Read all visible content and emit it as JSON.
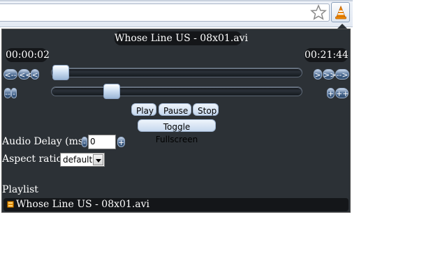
{
  "browser": {
    "star_icon": "star-icon",
    "extension_icon": "vlc-cone-icon"
  },
  "player": {
    "title": "Whose Line US - 08x01.avi",
    "time_current": "00:00:02",
    "time_total": "00:21:44",
    "seek_buttons_left": [
      "<--",
      "<<",
      "<"
    ],
    "seek_buttons_right": [
      ">",
      ">>",
      "-->"
    ],
    "volume_buttons_left": [
      "--",
      "-"
    ],
    "volume_buttons_right": [
      "+",
      "++"
    ],
    "seek_position": 0.0015,
    "volume_level": 0.25
  },
  "controls": {
    "play": "Play",
    "pause": "Pause",
    "stop": "Stop",
    "fullscreen": "Toggle Fullscreen"
  },
  "audio_delay": {
    "label": "Audio Delay (ms):",
    "minus": "-",
    "plus": "+",
    "value": "0"
  },
  "aspect": {
    "label": "Aspect ratio:",
    "selected": "default"
  },
  "playlist": {
    "label": "Playlist",
    "items": [
      {
        "name": "Whose Line US - 08x01.avi",
        "icon": "video-file-icon"
      }
    ]
  },
  "colors": {
    "panel_bg": "#2c3136",
    "pill_bg": "#141619",
    "small_button": "#4b6a92",
    "control_button": "#c6d8ee"
  }
}
